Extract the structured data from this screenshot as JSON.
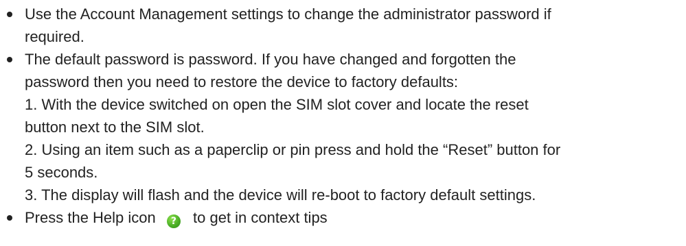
{
  "bullets": [
    {
      "lines": [
        "Use the Account Management settings to change the administrator password if",
        "required."
      ]
    },
    {
      "lines": [
        "The default password is password. If you have changed and forgotten the",
        "password then you need to restore the device to factory defaults:",
        "1. With the device switched on open the SIM slot cover and locate the reset",
        "button next to the SIM slot.",
        "2. Using an item such as a paperclip or pin press and hold the “Reset” button for",
        "5 seconds.",
        "3. The display will flash and the device will re-boot to factory default settings."
      ]
    },
    {
      "before_icon": "Press the Help icon",
      "icon": "help-icon",
      "icon_glyph": "?",
      "icon_color": "#4caf27",
      "after_icon": "to get in context tips"
    }
  ]
}
